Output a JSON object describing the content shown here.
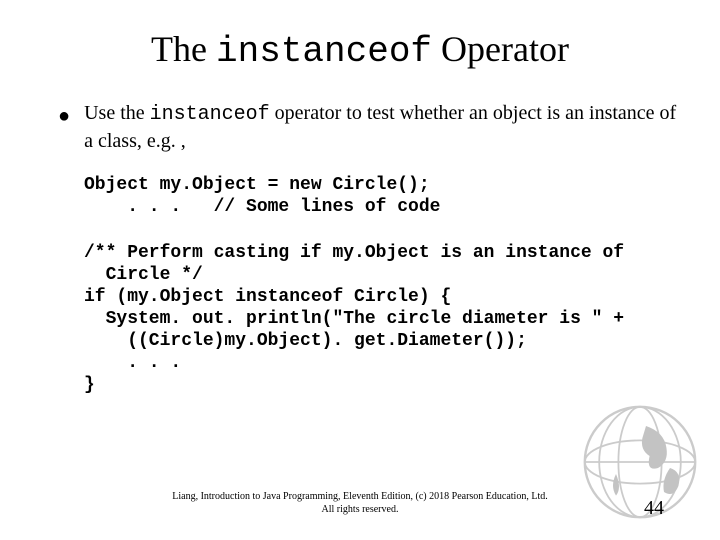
{
  "title": {
    "pre": "The ",
    "mono": "instanceof",
    "post": " Operator"
  },
  "bullet": {
    "pre": "Use the ",
    "mono": "instanceof",
    "post": " operator to test whether an object is an instance of a class, e.g. ,"
  },
  "code1": "Object my.Object = new Circle();\n    . . .   // Some lines of code",
  "code2": "/** Perform casting if my.Object is an instance of\n  Circle */\nif (my.Object instanceof Circle) {\n  System. out. println(\"The circle diameter is \" +\n    ((Circle)my.Object). get.Diameter());\n    . . .\n}",
  "footer_line1": "Liang, Introduction to Java Programming, Eleventh Edition, (c) 2018 Pearson Education, Ltd.",
  "footer_line2": "All rights reserved.",
  "page_number": "44"
}
